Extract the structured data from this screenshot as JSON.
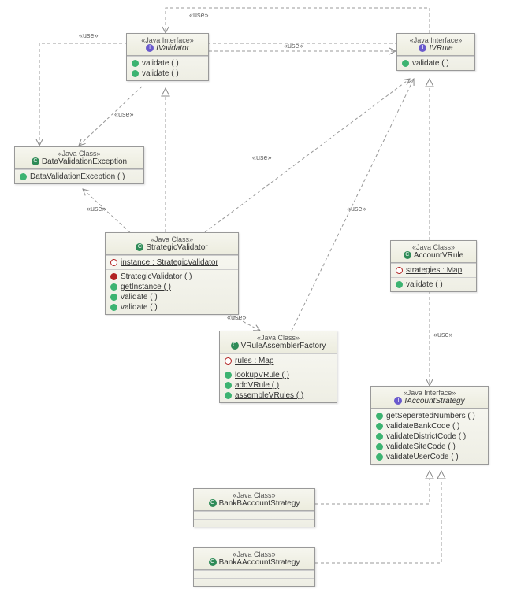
{
  "diagram": {
    "useLabel": "«use»",
    "stereotypes": {
      "interface": "«Java Interface»",
      "class": "«Java Class»"
    },
    "nodes": {
      "IValidator": {
        "stereotype": "«Java Interface»",
        "name": "IValidator",
        "icon": "interface",
        "attrs": [],
        "ops": [
          {
            "vis": "public",
            "text": "validate ( )"
          },
          {
            "vis": "public",
            "text": "validate ( )"
          }
        ]
      },
      "IVRule": {
        "stereotype": "«Java Interface»",
        "name": "IVRule",
        "icon": "interface",
        "attrs": [],
        "ops": [
          {
            "vis": "public",
            "text": "validate ( )"
          }
        ]
      },
      "DataValidationException": {
        "stereotype": "«Java Class»",
        "name": "DataValidationException",
        "icon": "class",
        "attrs": [],
        "ops": [
          {
            "vis": "public",
            "text": "DataValidationException ( )"
          }
        ]
      },
      "StrategicValidator": {
        "stereotype": "«Java Class»",
        "name": "StrategicValidator",
        "icon": "class",
        "attrs": [
          {
            "vis": "private",
            "text": "instance : StrategicValidator",
            "underline": true
          }
        ],
        "ops": [
          {
            "vis": "private-square",
            "text": "StrategicValidator ( )"
          },
          {
            "vis": "public",
            "text": "getInstance ( )",
            "underline": true
          },
          {
            "vis": "public",
            "text": "validate ( )"
          },
          {
            "vis": "public",
            "text": "validate ( )"
          }
        ]
      },
      "AccountVRule": {
        "stereotype": "«Java Class»",
        "name": "AccountVRule",
        "icon": "class",
        "attrs": [
          {
            "vis": "private",
            "text": "strategies : Map",
            "underline": true
          }
        ],
        "ops": [
          {
            "vis": "public",
            "text": "validate ( )"
          }
        ]
      },
      "VRuleAssemblerFactory": {
        "stereotype": "«Java Class»",
        "name": "VRuleAssemblerFactory",
        "icon": "class",
        "attrs": [
          {
            "vis": "private",
            "text": "rules : Map",
            "underline": true
          }
        ],
        "ops": [
          {
            "vis": "public",
            "text": "lookupVRule ( )",
            "underline": true
          },
          {
            "vis": "public",
            "text": "addVRule ( )",
            "underline": true
          },
          {
            "vis": "public",
            "text": "assembleVRules ( )",
            "underline": true
          }
        ]
      },
      "IAccountStrategy": {
        "stereotype": "«Java Interface»",
        "name": "IAccountStrategy",
        "icon": "interface",
        "attrs": [],
        "ops": [
          {
            "vis": "public",
            "text": "getSeperatedNumbers ( )"
          },
          {
            "vis": "public",
            "text": "validateBankCode ( )"
          },
          {
            "vis": "public",
            "text": "validateDistrictCode ( )"
          },
          {
            "vis": "public",
            "text": "validateSiteCode ( )"
          },
          {
            "vis": "public",
            "text": "validateUserCode ( )"
          }
        ]
      },
      "BankBAccountStrategy": {
        "stereotype": "«Java Class»",
        "name": "BankBAccountStrategy",
        "icon": "class",
        "attrs": [],
        "ops": []
      },
      "BankAAccountStrategy": {
        "stereotype": "«Java Class»",
        "name": "BankAAccountStrategy",
        "icon": "class",
        "attrs": [],
        "ops": []
      }
    },
    "relations": [
      {
        "from": "StrategicValidator",
        "to": "IValidator",
        "type": "realization"
      },
      {
        "from": "AccountVRule",
        "to": "IVRule",
        "type": "realization"
      },
      {
        "from": "BankBAccountStrategy",
        "to": "IAccountStrategy",
        "type": "realization"
      },
      {
        "from": "BankAAccountStrategy",
        "to": "IAccountStrategy",
        "type": "realization"
      },
      {
        "from": "IValidator",
        "to": "IVRule",
        "type": "use"
      },
      {
        "from": "IValidator",
        "to": "DataValidationException",
        "type": "use"
      },
      {
        "from": "IVRule",
        "to": "IValidator",
        "type": "use"
      },
      {
        "from": "IVRule",
        "to": "DataValidationException",
        "type": "use"
      },
      {
        "from": "StrategicValidator",
        "to": "DataValidationException",
        "type": "use"
      },
      {
        "from": "StrategicValidator",
        "to": "VRuleAssemblerFactory",
        "type": "use"
      },
      {
        "from": "StrategicValidator",
        "to": "IVRule",
        "type": "use"
      },
      {
        "from": "VRuleAssemblerFactory",
        "to": "IVRule",
        "type": "use"
      },
      {
        "from": "AccountVRule",
        "to": "IAccountStrategy",
        "type": "use"
      }
    ]
  }
}
